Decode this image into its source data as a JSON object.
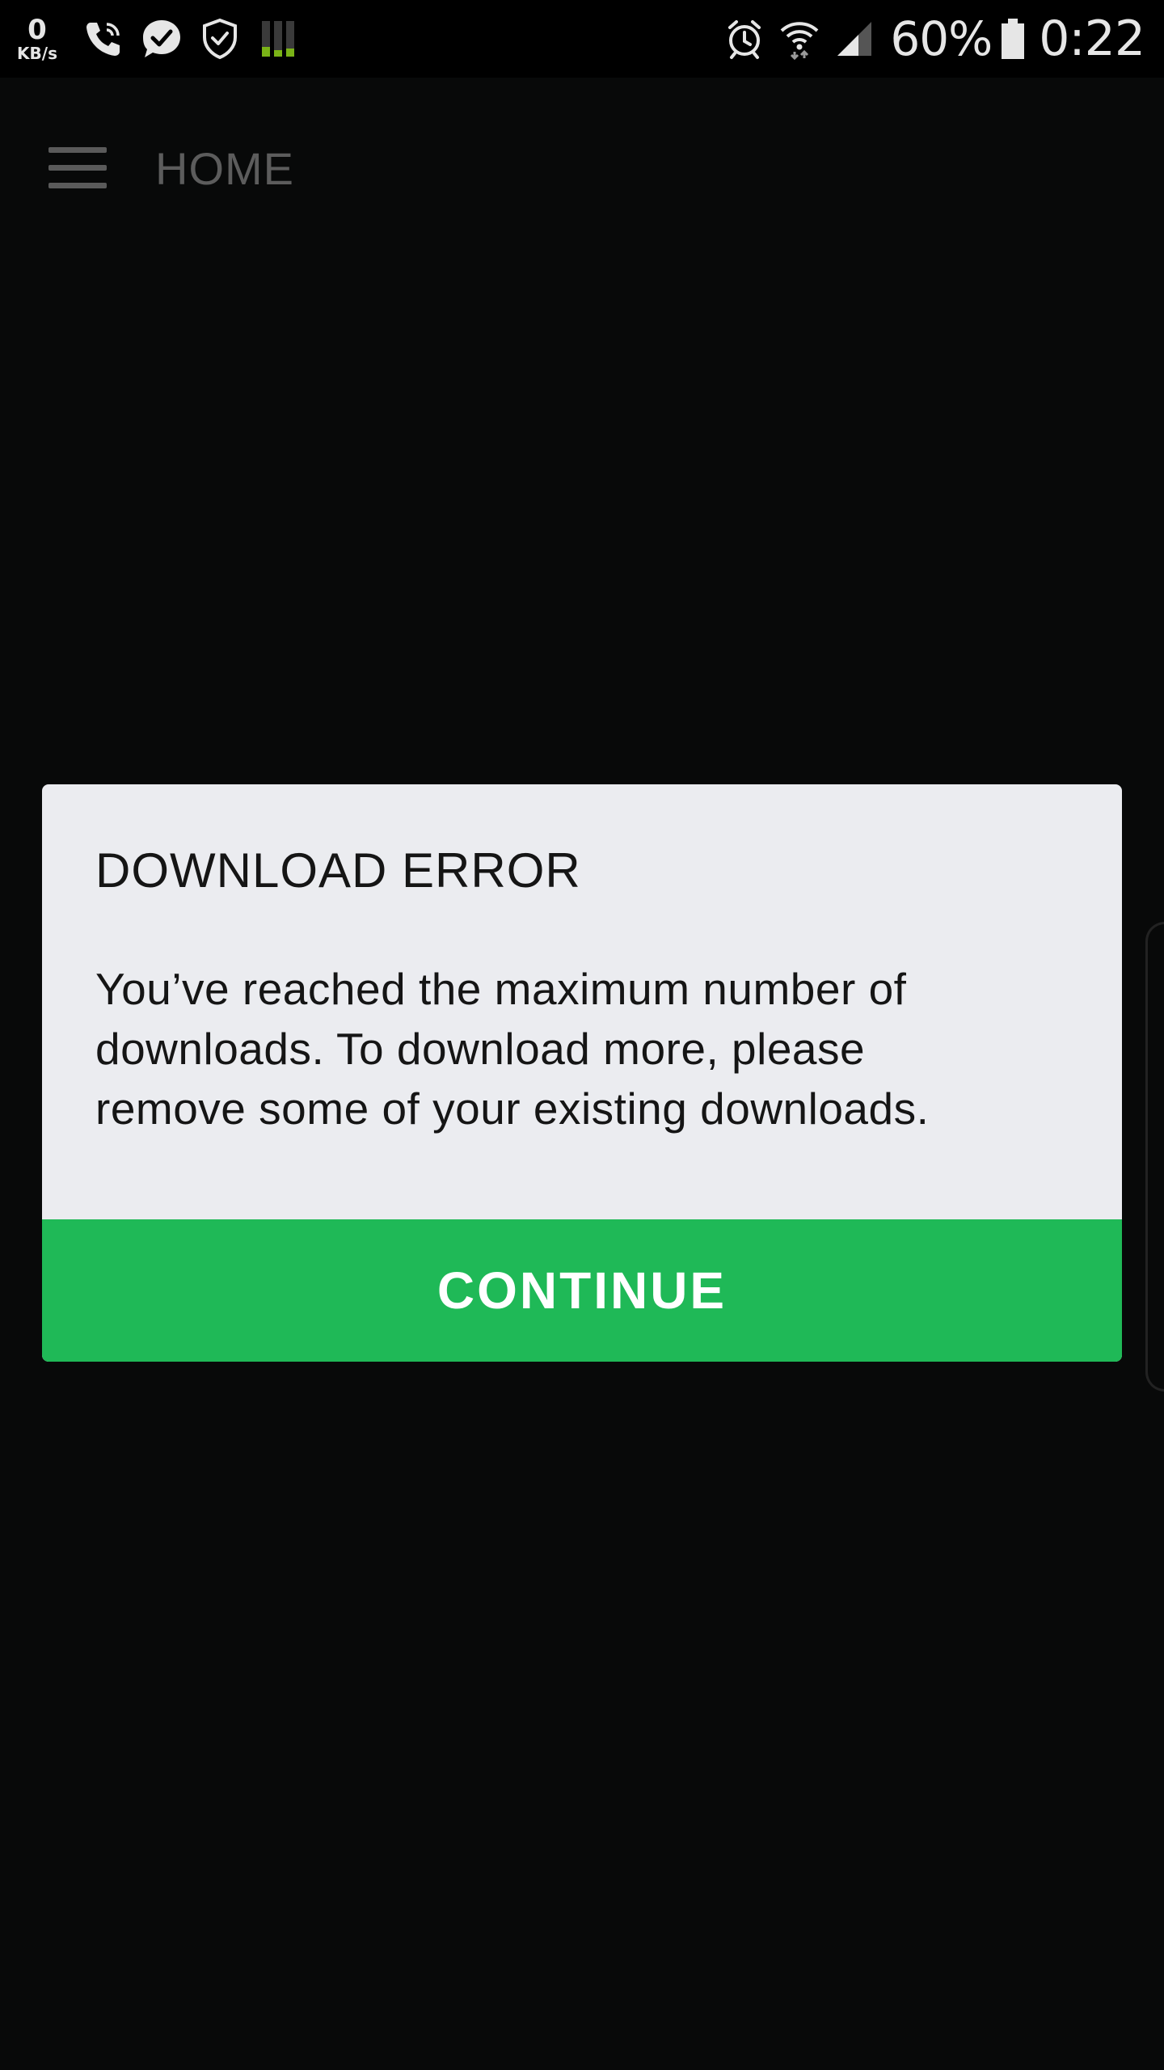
{
  "status_bar": {
    "net_speed_value": "0",
    "net_speed_unit": "KB/s",
    "battery_percent": "60%",
    "time": "0:22",
    "icons": [
      "phone-call-icon",
      "check-bubble-icon",
      "shield-check-icon",
      "equalizer-icon",
      "alarm-icon",
      "wifi-icon",
      "signal-icon",
      "battery-icon"
    ],
    "colors": {
      "equalizer_accent": "#7ab317"
    }
  },
  "app_bar": {
    "menu_icon": "hamburger-menu-icon",
    "title": "HOME"
  },
  "dialog": {
    "title": "DOWNLOAD ERROR",
    "message_lines": [
      "You’ve reached the maximum number of",
      "downloads. To download more, please",
      "remove some of your existing downloads."
    ],
    "continue_label": "CONTINUE",
    "colors": {
      "background": "#ebecf0",
      "button": "#1fb957",
      "button_text": "#ffffff"
    }
  }
}
